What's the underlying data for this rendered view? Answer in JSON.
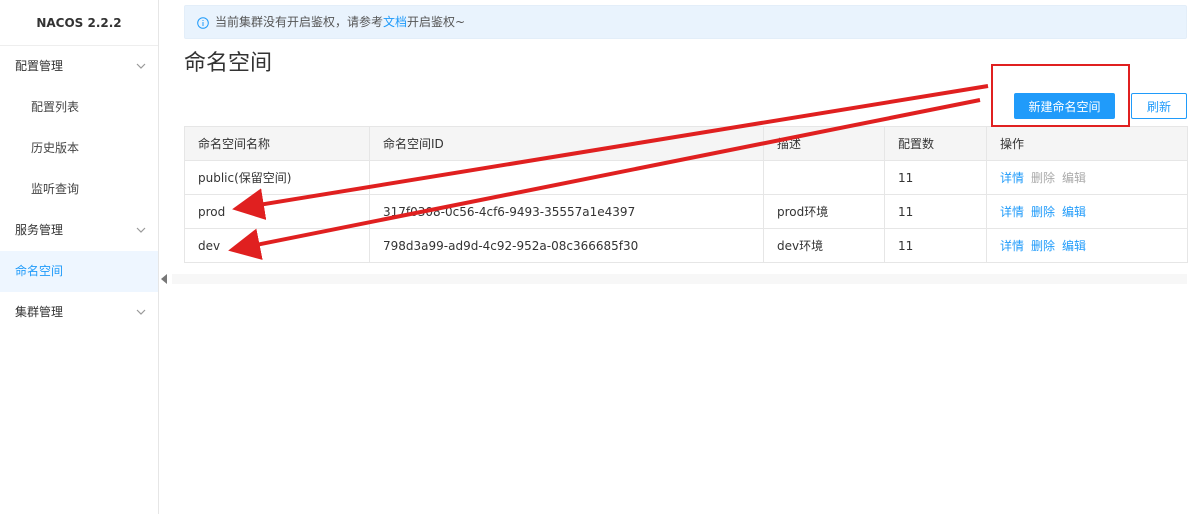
{
  "app": {
    "logo": "NACOS 2.2.2"
  },
  "sidebar": {
    "config_group": "配置管理",
    "config_items": [
      "配置列表",
      "历史版本",
      "监听查询"
    ],
    "service_group": "服务管理",
    "namespace_item": "命名空间",
    "cluster_group": "集群管理"
  },
  "notice": {
    "text_before": "当前集群没有开启鉴权，请参考",
    "link": "文档",
    "text_after": "开启鉴权~"
  },
  "page": {
    "title": "命名空间",
    "new_button": "新建命名空间",
    "refresh_button": "刷新"
  },
  "table": {
    "headers": [
      "命名空间名称",
      "命名空间ID",
      "描述",
      "配置数",
      "操作"
    ],
    "rows": [
      {
        "name": "public(保留空间)",
        "id": "",
        "desc": "",
        "count": "11",
        "ops": [
          "详情",
          "删除",
          "编辑"
        ]
      },
      {
        "name": "prod",
        "id": "317f0308-0c56-4cf6-9493-35557a1e4397",
        "desc": "prod环境",
        "count": "11",
        "ops": [
          "详情",
          "删除",
          "编辑"
        ]
      },
      {
        "name": "dev",
        "id": "798d3a99-ad9d-4c92-952a-08c366685f30",
        "desc": "dev环境",
        "count": "11",
        "ops": [
          "详情",
          "删除",
          "编辑"
        ]
      }
    ]
  },
  "colors": {
    "accent": "#209bfa",
    "annotation": "#e02020"
  },
  "icons": {
    "info": "info-circle-icon",
    "chevron": "chevron-down-icon",
    "collapse": "caret-left-icon"
  }
}
